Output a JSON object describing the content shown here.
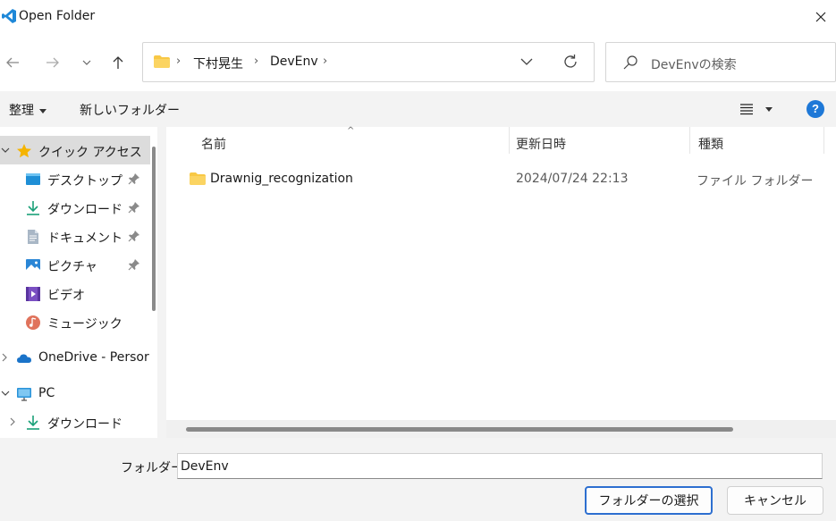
{
  "window": {
    "title": "Open Folder"
  },
  "breadcrumb": [
    "下村晃生",
    "DevEnv"
  ],
  "search": {
    "placeholder": "DevEnvの検索"
  },
  "commands": {
    "organize": "整理",
    "new_folder": "新しいフォルダー"
  },
  "sidebar": {
    "quick_access": "クイック アクセス",
    "items": [
      {
        "label": "デスクトップ",
        "icon": "desktop-icon",
        "pinned": true
      },
      {
        "label": "ダウンロード",
        "icon": "download-icon",
        "pinned": true
      },
      {
        "label": "ドキュメント",
        "icon": "document-icon",
        "pinned": true
      },
      {
        "label": "ピクチャ",
        "icon": "pictures-icon",
        "pinned": true
      },
      {
        "label": "ビデオ",
        "icon": "video-icon",
        "pinned": false
      },
      {
        "label": "ミュージック",
        "icon": "music-icon",
        "pinned": false
      }
    ],
    "onedrive": "OneDrive - Persor",
    "pc": "PC",
    "pc_downloads": "ダウンロード"
  },
  "columns": {
    "name": "名前",
    "modified": "更新日時",
    "type": "種類"
  },
  "files": [
    {
      "name": "Drawnig_recognization",
      "modified": "2024/07/24 22:13",
      "type": "ファイル フォルダー"
    }
  ],
  "footer": {
    "folder_label": "フォルダー:",
    "folder_value": "DevEnv",
    "select_button": "フォルダーの選択",
    "cancel_button": "キャンセル"
  },
  "colors": {
    "accent": "#2d6fd0",
    "folder": "#f8c845",
    "star": "#f5b400",
    "help": "#1e78d7"
  }
}
